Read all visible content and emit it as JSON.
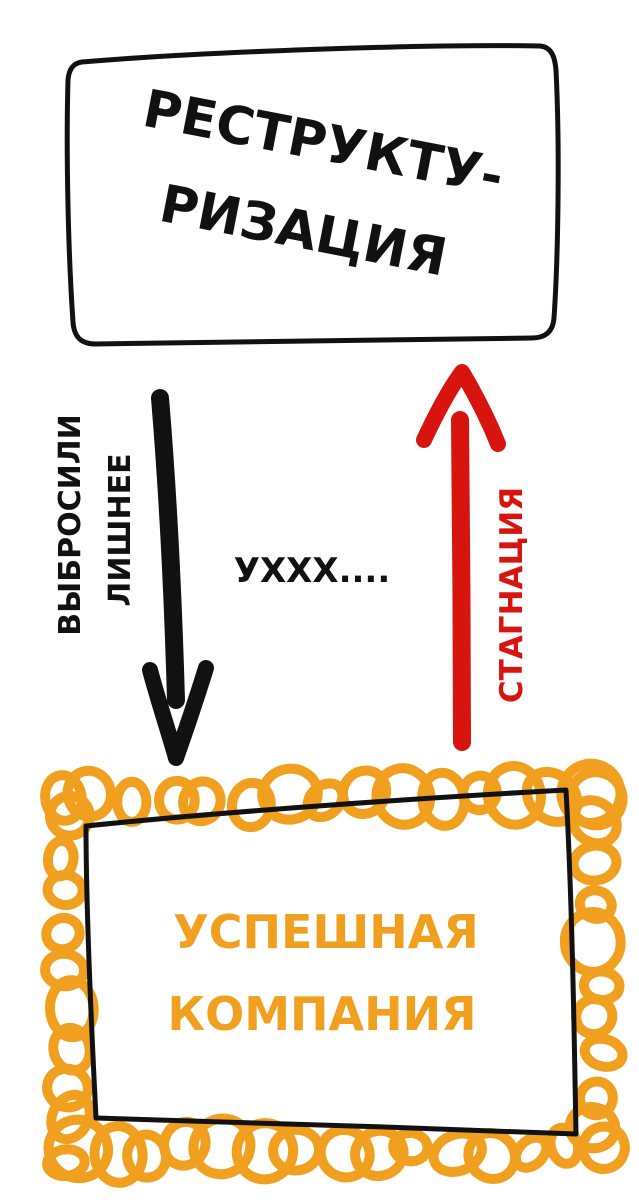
{
  "top_box": {
    "line1": "РЕСТРУКТУ-",
    "line2": "РИЗАЦИЯ"
  },
  "left_arrow": {
    "label_line1": "ВЫБРОСИЛИ",
    "label_line2": "ЛИШНЕЕ"
  },
  "middle_label": "УХХХ....",
  "right_arrow": {
    "label": "СТАГНАЦИЯ"
  },
  "bottom_box": {
    "line1": "УСПЕШНАЯ",
    "line2": "КОМПАНИЯ"
  },
  "colors": {
    "ink": "#111111",
    "red": "#d8140f",
    "orange": "#f0a01e"
  }
}
